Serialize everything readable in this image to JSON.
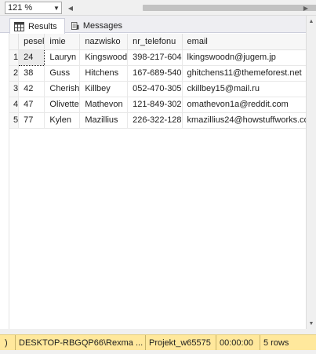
{
  "toolbar": {
    "zoom": "121 %"
  },
  "tabs": [
    {
      "label": "Results",
      "icon": "grid-icon"
    },
    {
      "label": "Messages",
      "icon": "messages-icon"
    }
  ],
  "grid": {
    "columns": [
      "pesel",
      "imie",
      "nazwisko",
      "nr_telefonu",
      "email"
    ],
    "rows": [
      {
        "n": "1",
        "pesel": "24",
        "imie": "Lauryn",
        "nazwisko": "Kingswood",
        "tel": "398-217-604",
        "email": "lkingswoodn@jugem.jp"
      },
      {
        "n": "2",
        "pesel": "38",
        "imie": "Guss",
        "nazwisko": "Hitchens",
        "tel": "167-689-540",
        "email": "ghitchens11@themeforest.net"
      },
      {
        "n": "3",
        "pesel": "42",
        "imie": "Cherish",
        "nazwisko": "Killbey",
        "tel": "052-470-305",
        "email": "ckillbey15@mail.ru"
      },
      {
        "n": "4",
        "pesel": "47",
        "imie": "Olivette",
        "nazwisko": "Mathevon",
        "tel": "121-849-302",
        "email": "omathevon1a@reddit.com"
      },
      {
        "n": "5",
        "pesel": "77",
        "imie": "Kylen",
        "nazwisko": "Mazillius",
        "tel": "226-322-128",
        "email": "kmazillius24@howstuffworks.com"
      }
    ]
  },
  "status": {
    "indicator": ")",
    "server": "DESKTOP-RBGQP66\\Rexma ...",
    "database": "Projekt_w65575",
    "elapsed": "00:00:00",
    "rows": "5 rows"
  },
  "colors": {
    "statusbar": "#ffe89c",
    "tab_border": "#cccedb"
  }
}
